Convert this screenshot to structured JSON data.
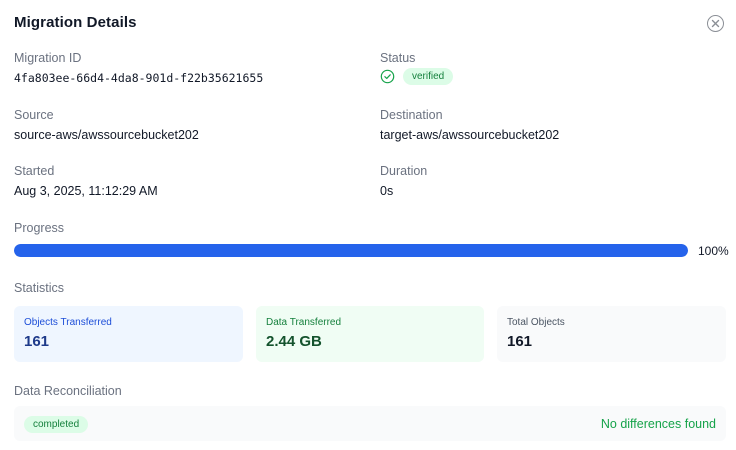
{
  "dialog": {
    "title": "Migration Details"
  },
  "fields": {
    "migration_id": {
      "label": "Migration ID",
      "value": "4fa803ee-66d4-4da8-901d-f22b35621655"
    },
    "status": {
      "label": "Status",
      "value": "verified"
    },
    "source": {
      "label": "Source",
      "value": "source-aws/awssourcebucket202"
    },
    "destination": {
      "label": "Destination",
      "value": "target-aws/awssourcebucket202"
    },
    "started": {
      "label": "Started",
      "value": "Aug 3, 2025, 11:12:29 AM"
    },
    "duration": {
      "label": "Duration",
      "value": "0s"
    }
  },
  "progress": {
    "label": "Progress",
    "percent": 100,
    "percent_text": "100%"
  },
  "statistics": {
    "label": "Statistics",
    "objects_transferred": {
      "label": "Objects Transferred",
      "value": "161"
    },
    "data_transferred": {
      "label": "Data Transferred",
      "value": "2.44 GB"
    },
    "total_objects": {
      "label": "Total Objects",
      "value": "161"
    }
  },
  "reconciliation": {
    "label": "Data Reconciliation",
    "status": "completed",
    "result": "No differences found"
  },
  "colors": {
    "accent": "#2563eb",
    "success": "#16a34a",
    "success_bg": "#dcfce7"
  },
  "icons": {
    "close": "close-icon",
    "status": "check-circle-icon"
  }
}
